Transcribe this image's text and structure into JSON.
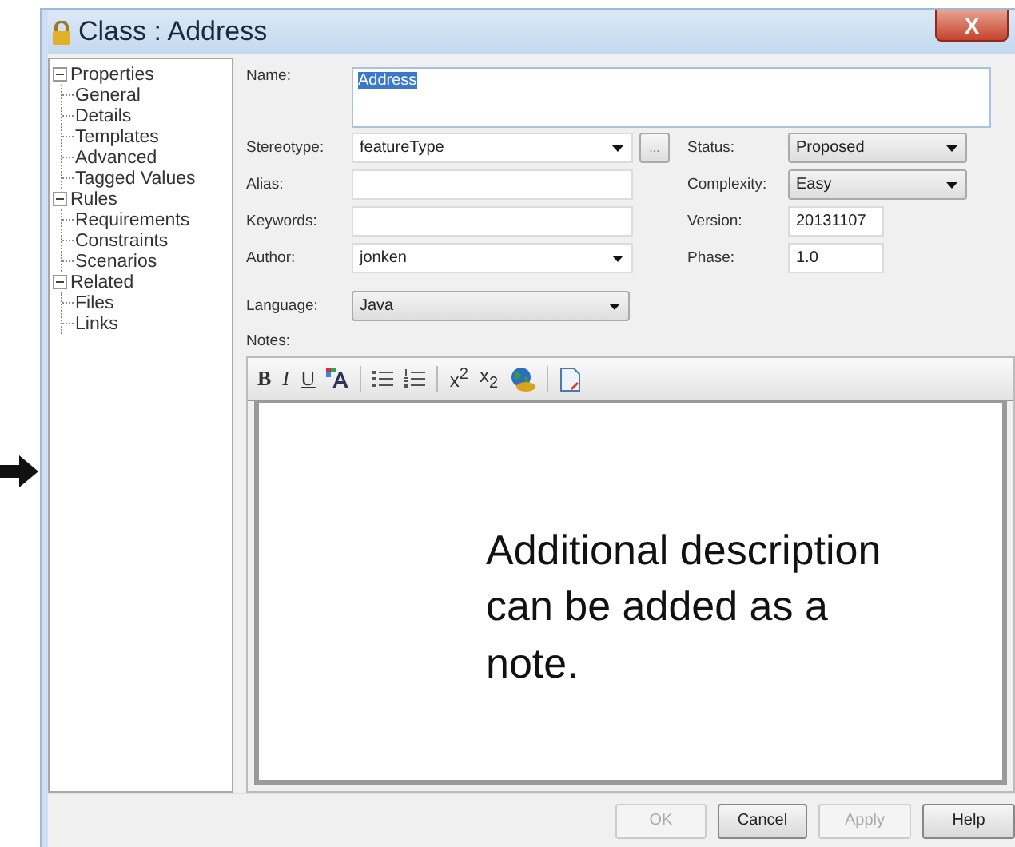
{
  "window": {
    "title": "Class : Address",
    "close": "X"
  },
  "tree": [
    {
      "label": "Properties",
      "expanded": true,
      "children": [
        {
          "label": "General"
        },
        {
          "label": "Details"
        },
        {
          "label": "Templates"
        },
        {
          "label": "Advanced"
        },
        {
          "label": "Tagged Values"
        }
      ]
    },
    {
      "label": "Rules",
      "expanded": true,
      "children": [
        {
          "label": "Requirements"
        },
        {
          "label": "Constraints"
        },
        {
          "label": "Scenarios"
        }
      ]
    },
    {
      "label": "Related",
      "expanded": true,
      "children": [
        {
          "label": "Files"
        },
        {
          "label": "Links"
        }
      ]
    }
  ],
  "name": {
    "label": "Name:",
    "value": "Address",
    "selected": true
  },
  "left_fields": [
    {
      "kind": "combo",
      "label": "Stereotype:",
      "value": "featureType",
      "browse": "..."
    },
    {
      "kind": "text",
      "label": "Alias:"
    },
    {
      "kind": "text",
      "label": "Keywords:"
    },
    {
      "kind": "combo",
      "label": "Author:",
      "value": "jonken"
    },
    {
      "kind": "dropdown",
      "label": "Language:",
      "value": "Java"
    }
  ],
  "right_fields": [
    {
      "kind": "dropdown",
      "label": "Status:",
      "value": "Proposed"
    },
    {
      "kind": "dropdown",
      "label": "Complexity:",
      "value": "Easy"
    },
    {
      "kind": "text",
      "label": "Version:",
      "value": "20131107"
    },
    {
      "kind": "text",
      "label": "Phase:",
      "value": "1.0"
    }
  ],
  "notes": {
    "label": "Notes:",
    "text": "Additional description can be added as a note."
  },
  "toolbar": [
    {
      "kind": "bold",
      "label": "B"
    },
    {
      "kind": "italic",
      "label": "I"
    },
    {
      "kind": "underline",
      "label": "U"
    },
    {
      "kind": "font-color"
    },
    {
      "kind": "separator"
    },
    {
      "kind": "bullets"
    },
    {
      "kind": "numbering"
    },
    {
      "kind": "separator"
    },
    {
      "kind": "script",
      "label": "x$^{2}$"
    },
    {
      "kind": "script",
      "label": "x$_{2}$"
    },
    {
      "kind": "globe"
    },
    {
      "kind": "separator"
    },
    {
      "kind": "document"
    }
  ],
  "buttons": [
    {
      "label": "OK",
      "disabled": true
    },
    {
      "label": "Cancel",
      "disabled": false
    },
    {
      "label": "Apply",
      "disabled": true
    },
    {
      "label": "Help",
      "disabled": false
    }
  ]
}
